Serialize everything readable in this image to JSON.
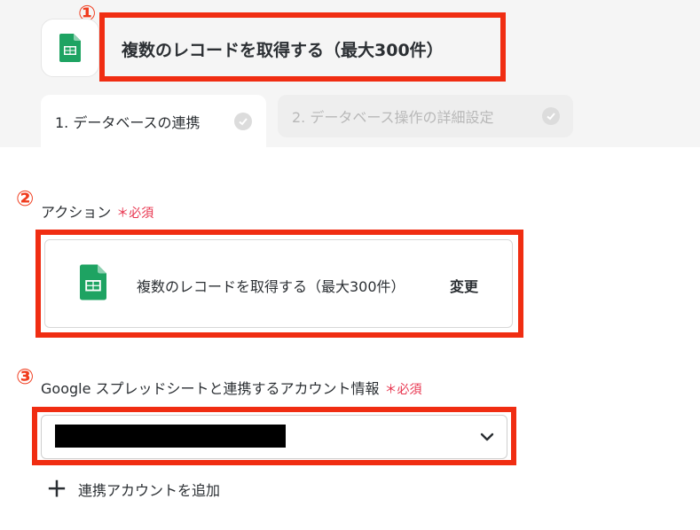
{
  "header": {
    "title": "複数のレコードを取得する（最大300件）",
    "app_icon": "google-sheets-icon"
  },
  "annotations": {
    "one": "①",
    "two": "②",
    "three": "③"
  },
  "tabs": [
    {
      "label": "1. データベースの連携",
      "active": true
    },
    {
      "label": "2. データベース操作の詳細設定",
      "active": false
    }
  ],
  "action_field": {
    "label": "アクション",
    "required": "＊必須",
    "value": "複数のレコードを取得する（最大300件）",
    "change_label": "変更",
    "icon": "google-sheets-icon"
  },
  "account_field": {
    "label": "Google スプレッドシートと連携するアカウント情報",
    "required": "＊必須",
    "icon": "chevron-down-icon"
  },
  "add_account": {
    "label": "連携アカウントを追加",
    "icon": "plus-icon"
  },
  "colors": {
    "annotation_red": "#f02d12",
    "required_pink": "#e8344e",
    "sheets_green": "#1ea362"
  }
}
